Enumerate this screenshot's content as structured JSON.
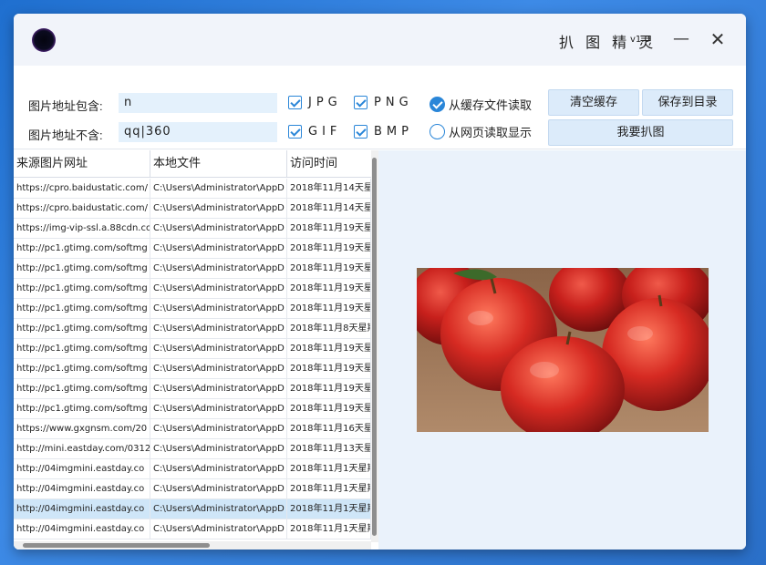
{
  "window": {
    "title": "扒 图 精 灵",
    "version": "v1.0",
    "minimize_glyph": "—",
    "close_glyph": "✕"
  },
  "filters": {
    "include_label": "图片地址包含:",
    "include_value": "n",
    "exclude_label": "图片地址不含:",
    "exclude_value": "qq|360"
  },
  "formats": [
    {
      "label": "JPG",
      "checked": true
    },
    {
      "label": "PNG",
      "checked": true
    },
    {
      "label": "GIF",
      "checked": true
    },
    {
      "label": "BMP",
      "checked": true
    }
  ],
  "source_options": [
    {
      "label": "从缓存文件读取",
      "selected": true
    },
    {
      "label": "从网页读取显示",
      "selected": false
    }
  ],
  "buttons": {
    "clear_cache": "清空缓存",
    "save_to_dir": "保存到目录",
    "grab": "我要扒图"
  },
  "table": {
    "columns": [
      "来源图片网址",
      "本地文件",
      "访问时间"
    ],
    "rows": [
      [
        "https://cpro.baidustatic.com/",
        "C:\\Users\\Administrator\\AppD",
        "2018年11月14天星"
      ],
      [
        "https://cpro.baidustatic.com/",
        "C:\\Users\\Administrator\\AppD",
        "2018年11月14天星"
      ],
      [
        "https://img-vip-ssl.a.88cdn.co",
        "C:\\Users\\Administrator\\AppD",
        "2018年11月19天星"
      ],
      [
        "http://pc1.gtimg.com/softmg",
        "C:\\Users\\Administrator\\AppD",
        "2018年11月19天星"
      ],
      [
        "http://pc1.gtimg.com/softmg",
        "C:\\Users\\Administrator\\AppD",
        "2018年11月19天星"
      ],
      [
        "http://pc1.gtimg.com/softmg",
        "C:\\Users\\Administrator\\AppD",
        "2018年11月19天星"
      ],
      [
        "http://pc1.gtimg.com/softmg",
        "C:\\Users\\Administrator\\AppD",
        "2018年11月19天星"
      ],
      [
        "http://pc1.gtimg.com/softmg",
        "C:\\Users\\Administrator\\AppD",
        "2018年11月8天星期"
      ],
      [
        "http://pc1.gtimg.com/softmg",
        "C:\\Users\\Administrator\\AppD",
        "2018年11月19天星"
      ],
      [
        "http://pc1.gtimg.com/softmg",
        "C:\\Users\\Administrator\\AppD",
        "2018年11月19天星"
      ],
      [
        "http://pc1.gtimg.com/softmg",
        "C:\\Users\\Administrator\\AppD",
        "2018年11月19天星"
      ],
      [
        "http://pc1.gtimg.com/softmg",
        "C:\\Users\\Administrator\\AppD",
        "2018年11月19天星"
      ],
      [
        "https://www.gxgnsm.com/20",
        "C:\\Users\\Administrator\\AppD",
        "2018年11月16天星"
      ],
      [
        "http://mini.eastday.com/0312",
        "C:\\Users\\Administrator\\AppD",
        "2018年11月13天星"
      ],
      [
        "http://04imgmini.eastday.co",
        "C:\\Users\\Administrator\\AppD",
        "2018年11月1天星期"
      ],
      [
        "http://04imgmini.eastday.co",
        "C:\\Users\\Administrator\\AppD",
        "2018年11月1天星期"
      ],
      [
        "http://04imgmini.eastday.co",
        "C:\\Users\\Administrator\\AppD",
        "2018年11月1天星期"
      ],
      [
        "http://04imgmini.eastday.co",
        "C:\\Users\\Administrator\\AppD",
        "2018年11月1天星期"
      ]
    ],
    "selected_row": 16
  },
  "preview": {
    "subject": "red apples photo"
  },
  "colors": {
    "accent": "#2a86d8",
    "field_bg": "#e4f1fc",
    "button_bg": "#dcebfa",
    "selected_row": "#cfe6f8"
  }
}
